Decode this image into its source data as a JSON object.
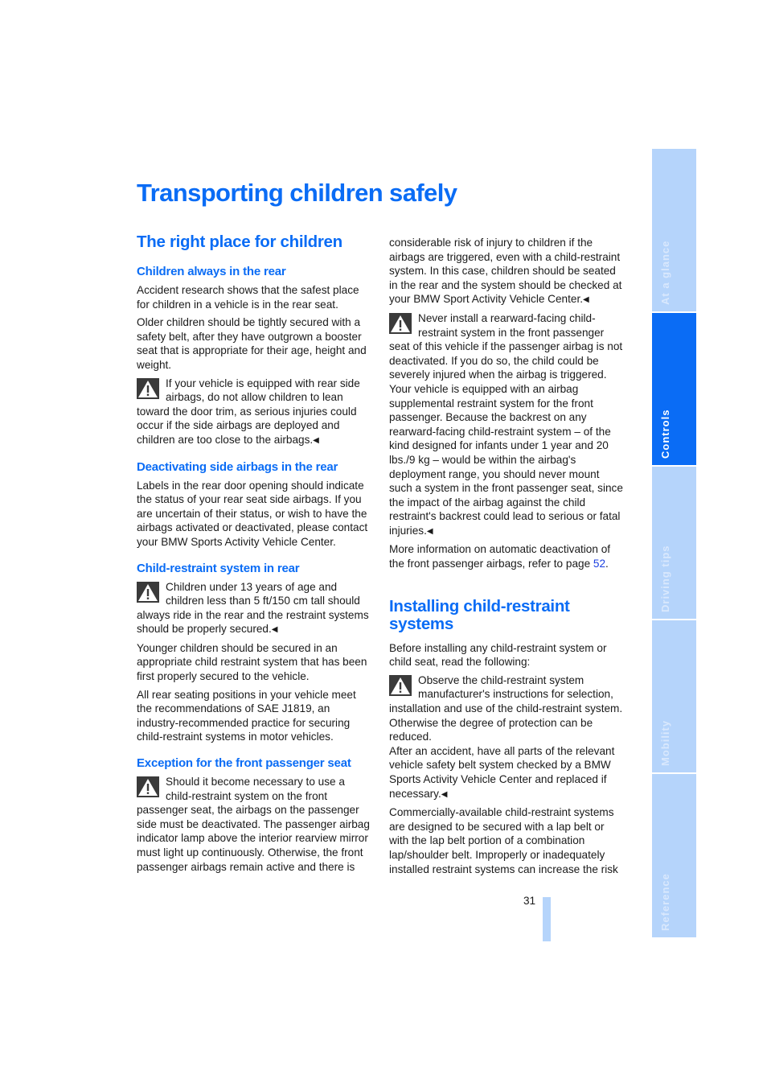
{
  "page": {
    "title": "Transporting children safely",
    "page_number": "31"
  },
  "side_tabs": [
    {
      "label": "At a glance",
      "active": false
    },
    {
      "label": "Controls",
      "active": true
    },
    {
      "label": "Driving tips",
      "active": false
    },
    {
      "label": "Mobility",
      "active": false
    },
    {
      "label": "Reference",
      "active": false
    }
  ],
  "section1": {
    "heading": "The right place for children",
    "sub1": {
      "heading": "Children always in the rear",
      "p1": "Accident research shows that the safest place for children in a vehicle is in the rear seat.",
      "p2": "Older children should be tightly secured with a safety belt, after they have outgrown a booster seat that is appropriate for their age, height and weight.",
      "warning": "If your vehicle is equipped with rear side airbags, do not allow children to lean toward the door trim, as serious injuries could occur if the side airbags are deployed and children are too close to the airbags."
    },
    "sub2": {
      "heading": "Deactivating side airbags in the rear",
      "p1": "Labels in the rear door opening should indicate the status of your rear seat side airbags. If you are uncertain of their status, or wish to have the airbags activated or deactivated, please contact your BMW Sports Activity Vehicle Center."
    },
    "sub3": {
      "heading": "Child-restraint system in rear",
      "warning": "Children under 13 years of age and children less than 5 ft/150 cm tall should always ride in the rear and the restraint systems should be properly secured.",
      "p1": "Younger children should be secured in an appropriate child restraint system that has been first properly secured to the vehicle.",
      "p2": "All rear seating positions in your vehicle meet the recommendations of SAE J1819, an industry-recommended practice for securing child-restraint systems in motor vehicles."
    },
    "sub4": {
      "heading": "Exception for the front passenger seat",
      "warning_part1": "Should it become necessary to use a child-restraint system on the front passenger seat, the airbags on the passenger side must be deactivated. The passenger airbag indicator lamp above the interior rearview mirror must light up continuously. Otherwise, the front passenger airbags remain active and there is",
      "warning_part2": "considerable risk of injury to children if the airbags are triggered, even with a child-restraint system. In this case, children should be seated in the rear and the system should be checked at your BMW Sport Activity Vehicle Center.",
      "warning2": "Never install a rearward-facing child-restraint system in the front passenger seat of this vehicle if the passenger airbag is not deactivated. If you do so, the child could be severely injured when the airbag is triggered. Your vehicle is equipped with an airbag supplemental restraint system for the front passenger. Because the backrest on any rearward-facing child-restraint system – of the kind designed for infants under 1 year and 20 lbs./9 kg – would be within the airbag's deployment range, you should never mount such a system in the front passenger seat, since the impact of the airbag against the child restraint's backrest could lead to serious or fatal injuries.",
      "more_info": "More information on automatic deactivation of the front passenger airbags, refer to page ",
      "more_info_link": "52",
      "more_info_end": "."
    }
  },
  "section2": {
    "heading": "Installing child-restraint systems",
    "p1": "Before installing any child-restraint system or child seat, read the following:",
    "warning_p1": "Observe the child-restraint system manufacturer's instructions for selection, installation and use of the child-restraint system. Otherwise the degree of protection can be reduced.",
    "warning_p2": "After an accident, have all parts of the relevant vehicle safety belt system checked by a BMW Sports Activity Vehicle Center and replaced if necessary.",
    "p2": "Commercially-available child-restraint systems are designed to be secured with a lap belt or with the lap belt portion of a combination lap/shoulder belt. Improperly or inadequately installed restraint systems can increase the risk"
  },
  "end_mark": "◀"
}
